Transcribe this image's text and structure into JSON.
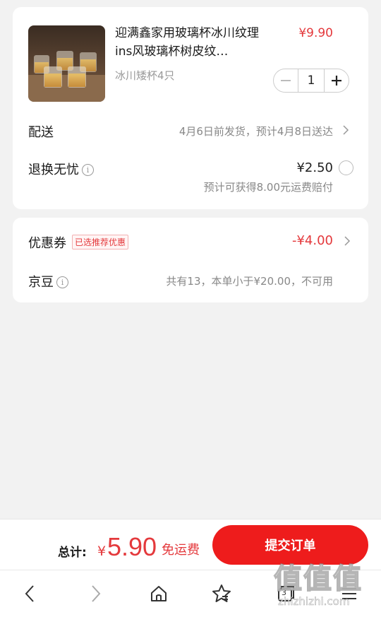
{
  "product": {
    "title": "迎满鑫家用玻璃杯冰川纹理ins风玻璃杯树皮纹…",
    "price": "¥9.90",
    "spec": "冰川矮杯4只",
    "quantity": "1"
  },
  "delivery": {
    "label": "配送",
    "value": "4月6日前发货，预计4月8日送达"
  },
  "returns": {
    "label": "退换无忧",
    "price": "¥2.50",
    "note": "预计可获得8.00元运费赔付"
  },
  "coupon": {
    "label": "优惠券",
    "tag": "已选推荐优惠",
    "value": "-¥4.00"
  },
  "jingdou": {
    "label": "京豆",
    "value": "共有13，本单小于¥20.00，不可用"
  },
  "footer": {
    "total_label": "总计:",
    "currency": "¥",
    "total": "5.90",
    "shipping": "免运费",
    "submit_label": "提交订单"
  },
  "navbar": {
    "tab_count": "3"
  },
  "watermark": {
    "text": "值值值",
    "subtext": "zhizhizhi.com"
  },
  "colors": {
    "accent": "#e4393c",
    "submit": "#ee1c1c",
    "background": "#f2f2f2"
  },
  "icons": [
    "minus-icon",
    "plus-icon",
    "chevron-right-icon",
    "info-icon",
    "back-icon",
    "forward-icon",
    "home-icon",
    "star-icon",
    "tabs-icon",
    "menu-icon"
  ]
}
